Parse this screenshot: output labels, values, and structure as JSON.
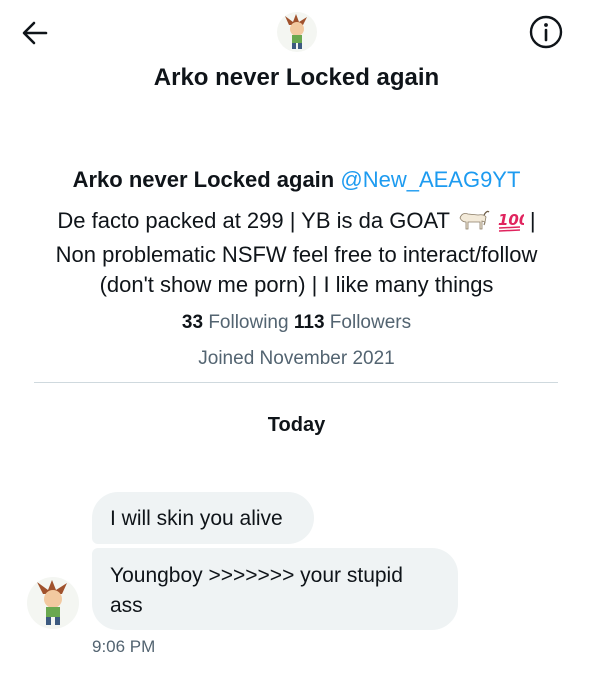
{
  "header": {
    "title": "Arko never Locked again",
    "back_icon": "back-arrow-icon",
    "info_icon": "info-icon"
  },
  "profile": {
    "name": "Arko never Locked again",
    "handle": "@New_AEAG9YT",
    "bio_text_1": "De facto packed at 299 | YB is da GOAT ",
    "bio_text_2": " |",
    "bio_text_3": "Non problematic NSFW feel free to interact/follow (don't show me porn) | I like many things",
    "emoji_goat": "goat-icon",
    "emoji_100": "hundred-points-icon",
    "following_count": "33",
    "following_label": "Following",
    "followers_count": "113",
    "followers_label": "Followers",
    "joined": "Joined November 2021"
  },
  "conversation": {
    "date_label": "Today",
    "messages": [
      {
        "text": "I will skin you alive"
      },
      {
        "text": "Youngboy >>>>>>> your stupid ass"
      }
    ],
    "timestamp": "9:06 PM"
  },
  "colors": {
    "accent": "#1d9bf0",
    "bubble": "#eff3f4",
    "secondary_text": "#536471",
    "divider": "#cfd9de"
  }
}
